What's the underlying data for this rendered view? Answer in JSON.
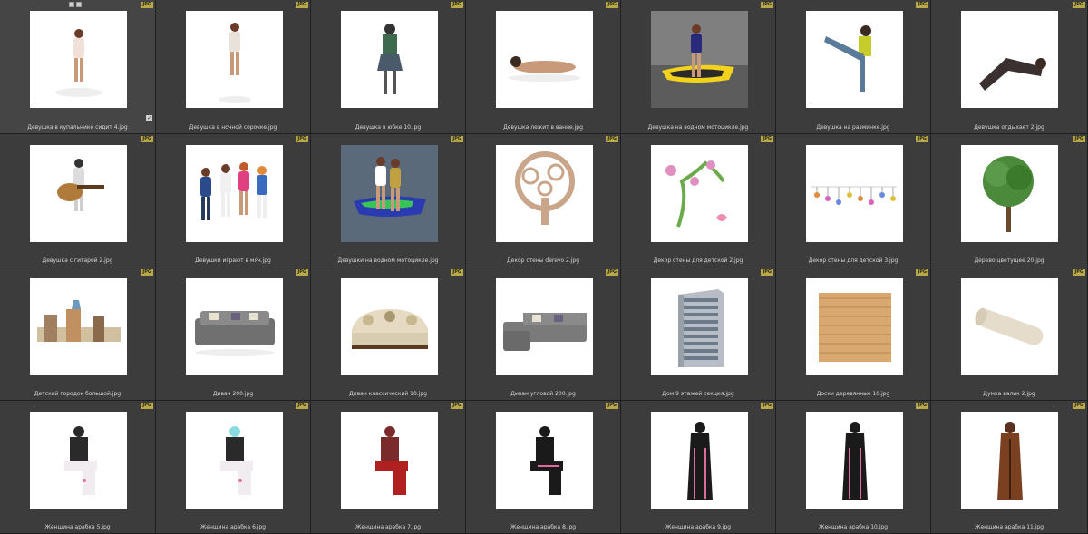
{
  "browser": {
    "badge_text": "JPG",
    "rows": [
      [
        {
          "name": "Девушка в купальнике сидит 4.jpg",
          "art": "pose-kneel",
          "selected": true
        },
        {
          "name": "Девушка в ночной сорочке.jpg",
          "art": "woman-dress"
        },
        {
          "name": "Девушка в юбке 10.jpg",
          "art": "woman-skirt"
        },
        {
          "name": "Девушка лежит в ванне.jpg",
          "art": "woman-lying"
        },
        {
          "name": "Девушка на водном мотоцикле.jpg",
          "art": "jetski-water-yellow"
        },
        {
          "name": "Девушка на разминке.jpg",
          "art": "woman-kick"
        },
        {
          "name": "Девушка отдыхает 2.jpg",
          "art": "woman-rest"
        }
      ],
      [
        {
          "name": "Девушка с гитарой 2.jpg",
          "art": "woman-guitar"
        },
        {
          "name": "Девушки играют в мяч.jpg",
          "art": "girls-group"
        },
        {
          "name": "Девушки на водном мотоцикле.jpg",
          "art": "jetski-water-green"
        },
        {
          "name": "Декор стены derevo 2.jpg",
          "art": "tree-swirl"
        },
        {
          "name": "Декор стены для детской 2.jpg",
          "art": "vine-decor"
        },
        {
          "name": "Декор стены для детской 3.jpg",
          "art": "garland"
        },
        {
          "name": "Дерево цветущее 20.jpg",
          "art": "tree-real"
        }
      ],
      [
        {
          "name": "Детский городок большой.jpg",
          "art": "playground"
        },
        {
          "name": "Диван 200.jpg",
          "art": "sofa-grey"
        },
        {
          "name": "Диван классический 10.jpg",
          "art": "sofa-classic"
        },
        {
          "name": "Диван угловой 200.jpg",
          "art": "sofa-corner"
        },
        {
          "name": "Дом 9 этажей секция.jpg",
          "art": "building"
        },
        {
          "name": "Доски деревянные 10.jpg",
          "art": "wood-boards"
        },
        {
          "name": "Думка валик 2.jpg",
          "art": "bolster"
        }
      ],
      [
        {
          "name": "Женщина арабка 5.jpg",
          "art": "arab-sit-white"
        },
        {
          "name": "Женщина арабка 6.jpg",
          "art": "arab-sit-white2"
        },
        {
          "name": "Женщина арабка 7.jpg",
          "art": "arab-sit-red"
        },
        {
          "name": "Женщина арабка 8.jpg",
          "art": "arab-sit-black"
        },
        {
          "name": "Женщина арабка 9.jpg",
          "art": "arab-stand-black"
        },
        {
          "name": "Женщина арабка 10.jpg",
          "art": "arab-stand-black2"
        },
        {
          "name": "Женщина арабка 11.jpg",
          "art": "arab-stand-brown"
        }
      ]
    ]
  }
}
